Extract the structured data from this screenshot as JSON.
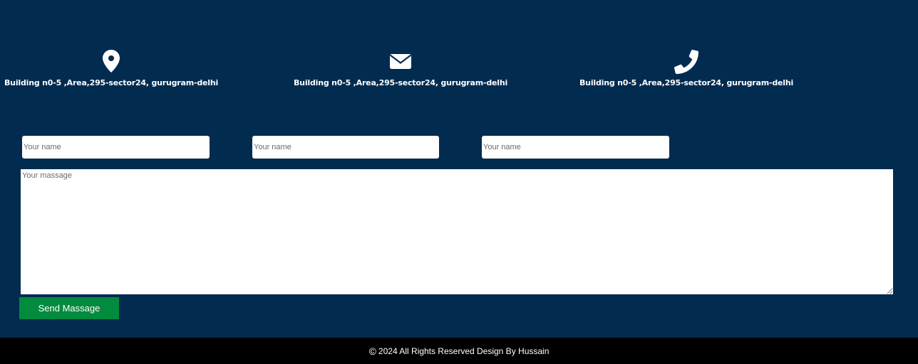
{
  "colors": {
    "background": "#022b50",
    "button": "#028a3e",
    "footer": "#000000",
    "text": "#ffffff"
  },
  "info": [
    {
      "icon": "location-pin-icon",
      "text": "Building n0-5 ,Area,295-sector24, gurugram-delhi"
    },
    {
      "icon": "envelope-icon",
      "text": "Building n0-5 ,Area,295-sector24, gurugram-delhi"
    },
    {
      "icon": "phone-icon",
      "text": "Building n0-5 ,Area,295-sector24, gurugram-delhi"
    }
  ],
  "form": {
    "fields": [
      {
        "placeholder": "Your name",
        "value": ""
      },
      {
        "placeholder": "Your name",
        "value": ""
      },
      {
        "placeholder": "Your name",
        "value": ""
      }
    ],
    "message_placeholder": "Your massage",
    "message_value": "",
    "submit_label": "Send Massage"
  },
  "footer": {
    "copyright_symbol": "©",
    "text": "2024 All Rights Reserved Design By Hussain"
  }
}
